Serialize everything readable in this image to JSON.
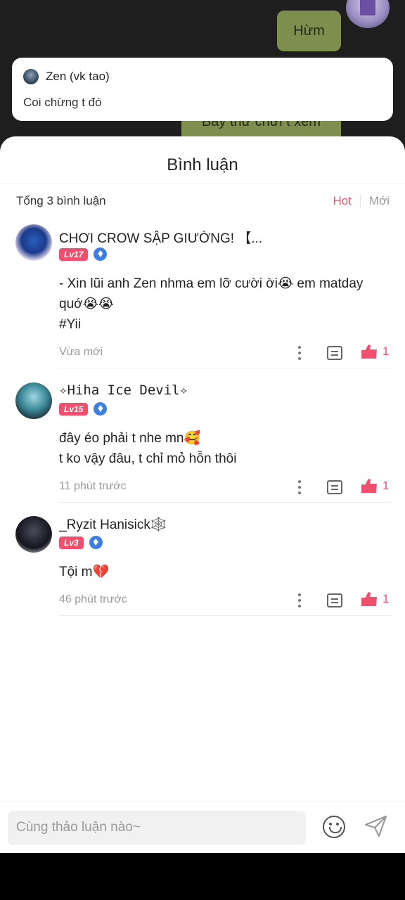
{
  "chat": {
    "bubble1": "Hừm",
    "bubble2": "Bây thử chửi t xem"
  },
  "notification": {
    "name": "Zen (vk tao)",
    "text": "Coi chừng t đó"
  },
  "sheet": {
    "title": "Bình luận",
    "count": "Tổng 3 bình luận",
    "sort_hot": "Hot",
    "sort_new": "Mới"
  },
  "comments": [
    {
      "name": "CHƠI CROW SẬP GIƯỜNG! 【...",
      "level": "Lv17",
      "text": "- Xin lũi anh Zen nhma em lỡ cười ời😭 em matday\nquớ😭😭\n#Yii",
      "time": "Vừa mới",
      "likes": "1"
    },
    {
      "name": "✧Hiha Ice Devil✧",
      "level": "Lv15",
      "text": "đây éo phải t nhe mn🥰\nt ko vậy đâu, t chỉ mỏ hỗn thôi",
      "time": "11 phút trước",
      "likes": "1"
    },
    {
      "name": "_Ryzit Hanisick🕸️",
      "level": "Lv3",
      "text": "Tội m💔",
      "time": "46 phút trước",
      "likes": "1"
    }
  ],
  "input": {
    "placeholder": "Cùng thảo luận nào~"
  },
  "colors": {
    "accent": "#f0506e",
    "bubble": "#7d8e4e"
  }
}
